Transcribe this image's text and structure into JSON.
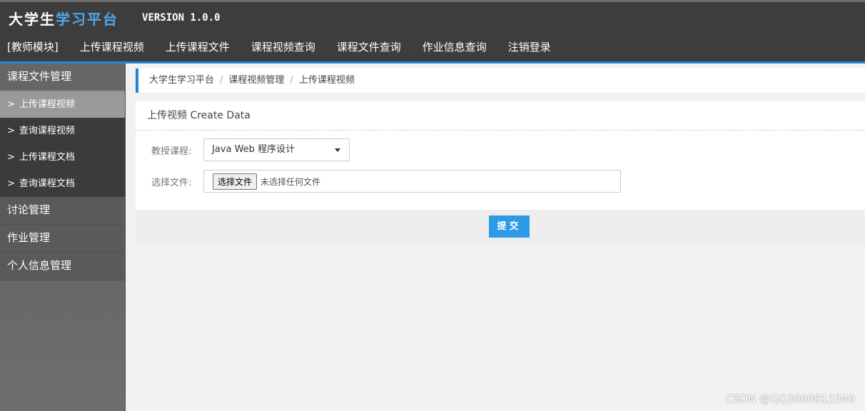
{
  "header": {
    "logo_white": "大学生",
    "logo_blue": "学习平台",
    "version": "VERSION 1.0.0",
    "nav": [
      "[教师模块]",
      "上传课程视频",
      "上传课程文件",
      "课程视频查询",
      "课程文件查询",
      "作业信息查询",
      "注销登录"
    ]
  },
  "sidebar": {
    "groups": [
      {
        "label": "课程文件管理",
        "items": [
          "上传课程视频",
          "查询课程视频",
          "上传课程文档",
          "查询课程文档"
        ]
      },
      {
        "label": "讨论管理"
      },
      {
        "label": "作业管理"
      },
      {
        "label": "个人信息管理"
      }
    ],
    "arrow": ">"
  },
  "breadcrumb": [
    "大学生学习平台",
    "课程视频管理",
    "上传课程视频"
  ],
  "breadcrumb_sep": "/",
  "form": {
    "title": "上传视频 Create Data",
    "course_label": "教授课程:",
    "course_value": "Java Web 程序设计",
    "file_label": "选择文件:",
    "file_button": "选择文件",
    "file_status": "未选择任何文件",
    "submit": "提交"
  },
  "watermark": "CSDN @QQ3060912346",
  "colors": {
    "accent": "#1e88d0",
    "header_bg": "#3d3d3d",
    "submit_bg": "#2e9ae6"
  }
}
